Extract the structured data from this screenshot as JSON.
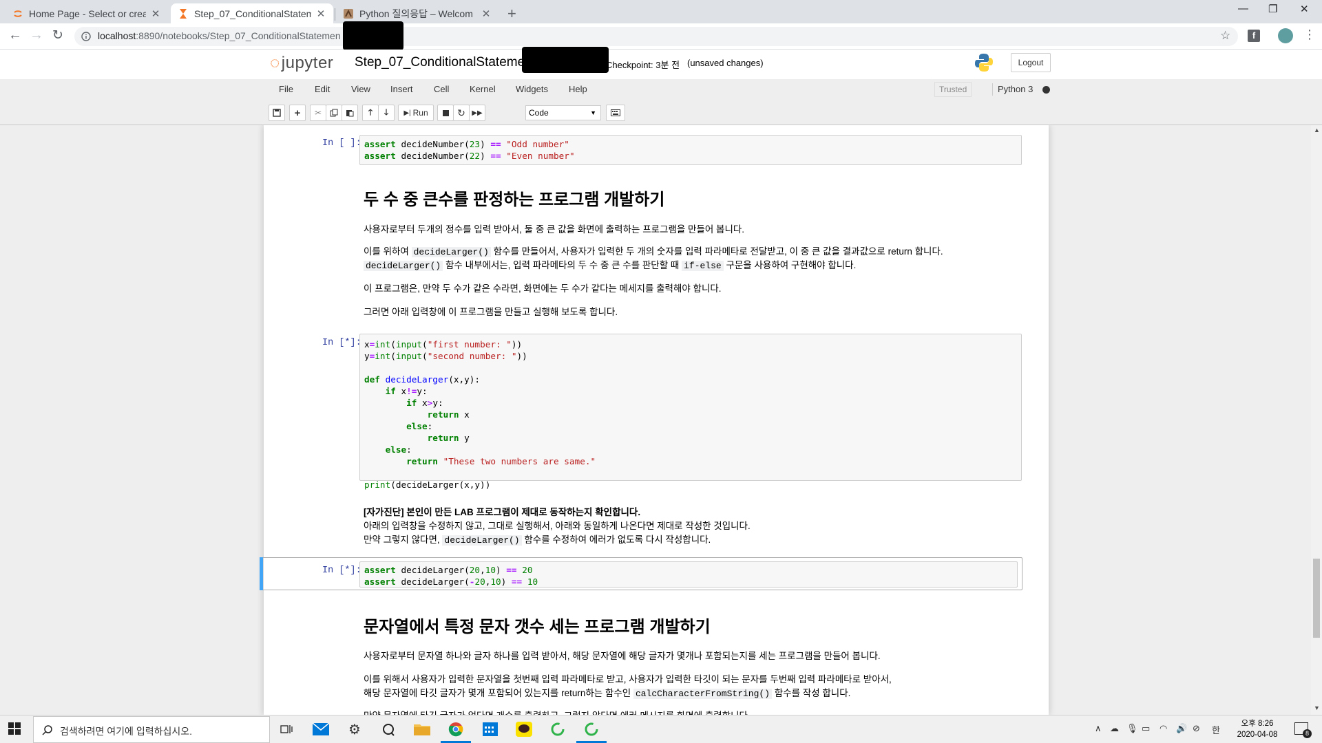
{
  "browser": {
    "tabs": [
      {
        "title": "Home Page - Select or create",
        "active": false
      },
      {
        "title": "Step_07_ConditionalStatem",
        "active": true
      },
      {
        "title": "Python 질의응답 – Welcom",
        "active": false
      }
    ],
    "url_host": "localhost",
    "url_path": ":8890/notebooks/Step_07_ConditionalStatemen"
  },
  "jupyter": {
    "logo": "jupyter",
    "notebook_name": "Step_07_ConditionalStateme",
    "checkpoint": "Checkpoint: 3분 전",
    "unsaved": "(unsaved changes)",
    "logout": "Logout",
    "menus": [
      "File",
      "Edit",
      "View",
      "Insert",
      "Cell",
      "Kernel",
      "Widgets",
      "Help"
    ],
    "trusted": "Trusted",
    "kernel": "Python 3",
    "toolbar": {
      "run": "Run",
      "cell_type": "Code"
    }
  },
  "cells": {
    "c1": {
      "prompt": "In [ ]:",
      "lines": [
        "assert decideNumber(23) == \"Odd number\"",
        "assert decideNumber(22) == \"Even number\""
      ]
    },
    "md1": {
      "heading": "두 수 중 큰수를 판정하는 프로그램 개발하기",
      "p1": "사용자로부터 두개의 정수를 입력 받아서, 둘 중 큰 값을 화면에 출력하는 프로그램을 만들어 봅니다.",
      "p2a": "이를 위하여",
      "p2code": "decideLarger()",
      "p2b": "함수를 만들어서, 사용자가 입력한 두 개의 숫자를 입력 파라메타로 전달받고, 이 중 큰 값을 결과값으로 return 합니다.",
      "p3code": "decideLarger()",
      "p3a": "함수 내부에서는, 입력 파라메타의 두 수 중 큰 수를 판단할 때",
      "p3code2": "if-else",
      "p3b": "구문을 사용하여 구현해야 합니다.",
      "p4": "이 프로그램은, 만약 두 수가 같은 수라면, 화면에는 두 수가 같다는 메세지를 출력해야 합니다.",
      "p5": "그러면 아래 입력창에 이 프로그램을 만들고 실행해 보도록 합니다."
    },
    "c2": {
      "prompt": "In [*]:",
      "l1": "x=int(input(\"first number: \"))",
      "l2": "y=int(input(\"second number: \"))",
      "l3": "def decideLarger(x,y):",
      "l4": "    if x!=y:",
      "l5": "        if x>y:",
      "l6": "            return x",
      "l7": "        else:",
      "l8": "            return y",
      "l9": "    else:",
      "l10": "        return \"These two numbers are same.\"",
      "l11": "print(decideLarger(x,y))"
    },
    "md2": {
      "bold": "[자가진단] 본인이 만든 LAB 프로그램이 제대로 동작하는지 확인합니다.",
      "line2": "아래의 입력창을 수정하지 않고, 그대로 실행해서, 아래와 동일하게 나온다면 제대로 작성한 것입니다.",
      "line3a": "만약 그렇지 않다면,",
      "line3code": "decideLarger()",
      "line3b": "함수를 수정하여 에러가 없도록 다시 작성합니다."
    },
    "c3": {
      "prompt": "In [*]:",
      "lines": [
        "assert decideLarger(20,10) == 20",
        "assert decideLarger(-20,10) == 10"
      ]
    },
    "md3": {
      "heading": "문자열에서 특정 문자 갯수 세는 프로그램 개발하기",
      "p1": "사용자로부터 문자열 하나와 글자 하나를 입력 받아서, 해당 문자열에 해당 글자가 몇개나 포함되는지를 세는 프로그램을 만들어 봅니다.",
      "p2": "이를 위해서 사용자가 입력한 문자열을 첫번째 입력 파라메타로 받고, 사용자가 입력한 타깃이 되는 문자를 두번째 입력 파라메타로 받아서,",
      "p3a": "해당 문자열에 타깃 글자가 몇개 포함되어 있는지를 return하는 함수인",
      "p3code": "calcCharacterFromString()",
      "p3b": "함수를 작성 합니다.",
      "p4": "만약 문자열에 타깃 글자가 없다면 개수를 출력하고, 그렇지 않다면 에러 메시지를 화면에 출력합니다."
    }
  },
  "taskbar": {
    "search_placeholder": "검색하려면 여기에 입력하십시오.",
    "time": "오후 8:26",
    "date": "2020-04-08",
    "ime": "한",
    "notifications": "8"
  }
}
